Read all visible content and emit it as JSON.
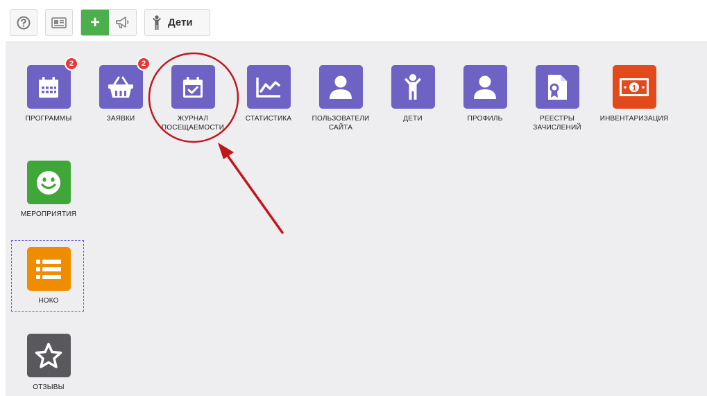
{
  "toolbar": {
    "help_icon": "question-circle-icon",
    "card_icon": "id-card-icon",
    "plus_label": "+",
    "megaphone_icon": "megaphone-icon",
    "kids_label": "Дети",
    "kids_icon": "child-icon"
  },
  "tiles": [
    {
      "label": "ПРОГРАММЫ",
      "badge": "2",
      "icon": "calendar-icon",
      "color": "#6e62c4"
    },
    {
      "label": "ЗАЯВКИ",
      "badge": "2",
      "icon": "basket-icon",
      "color": "#6e62c4"
    },
    {
      "label_line1": "ЖУРНАЛ",
      "label_line2": "ПОСЕЩАЕМОСТИ",
      "icon": "calendar-check-icon",
      "color": "#6e62c4"
    },
    {
      "label": "СТАТИСТИКА",
      "icon": "chart-line-icon",
      "color": "#6e62c4"
    },
    {
      "label_line1": "ПОЛЬЗОВАТЕЛИ",
      "label_line2": "САЙТА",
      "icon": "user-icon",
      "color": "#6e62c4"
    },
    {
      "label": "ДЕТИ",
      "icon": "child-icon",
      "color": "#6e62c4"
    },
    {
      "label": "ПРОФИЛЬ",
      "icon": "user-icon",
      "color": "#6e62c4"
    },
    {
      "label_line1": "РЕЕСТРЫ",
      "label_line2": "ЗАЧИСЛЕНИЙ",
      "icon": "certificate-icon",
      "color": "#6e62c4"
    },
    {
      "label": "ИНВЕНТАРИЗАЦИЯ",
      "icon": "banknote-icon",
      "color": "#e34a1b"
    },
    {
      "label": "МЕРОПРИЯТИЯ",
      "icon": "smile-icon",
      "color": "#3fa63a"
    },
    {
      "label": "НОКО",
      "icon": "list-icon",
      "color": "#f08c00"
    },
    {
      "label": "ОТЗЫВЫ",
      "icon": "star-icon",
      "color": "#59585c"
    }
  ],
  "annotation": {
    "color": "#c0171c"
  }
}
